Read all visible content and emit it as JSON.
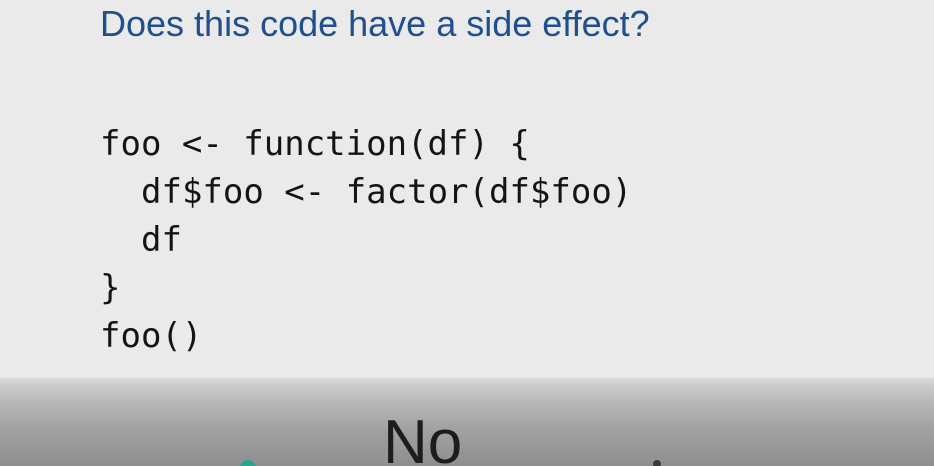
{
  "slide": {
    "title": "Does this code have a side effect?",
    "code_lines": [
      "foo <- function(df) {",
      "df$foo <- factor(df$foo)",
      "df",
      "}",
      "foo()"
    ]
  },
  "answer": {
    "text": "No"
  },
  "colors": {
    "title": "#1f4f8f",
    "background": "#e9eae9",
    "code": "#141414",
    "answer_bar": "#a3a3a3",
    "accent_dot": "#2aa58f"
  }
}
